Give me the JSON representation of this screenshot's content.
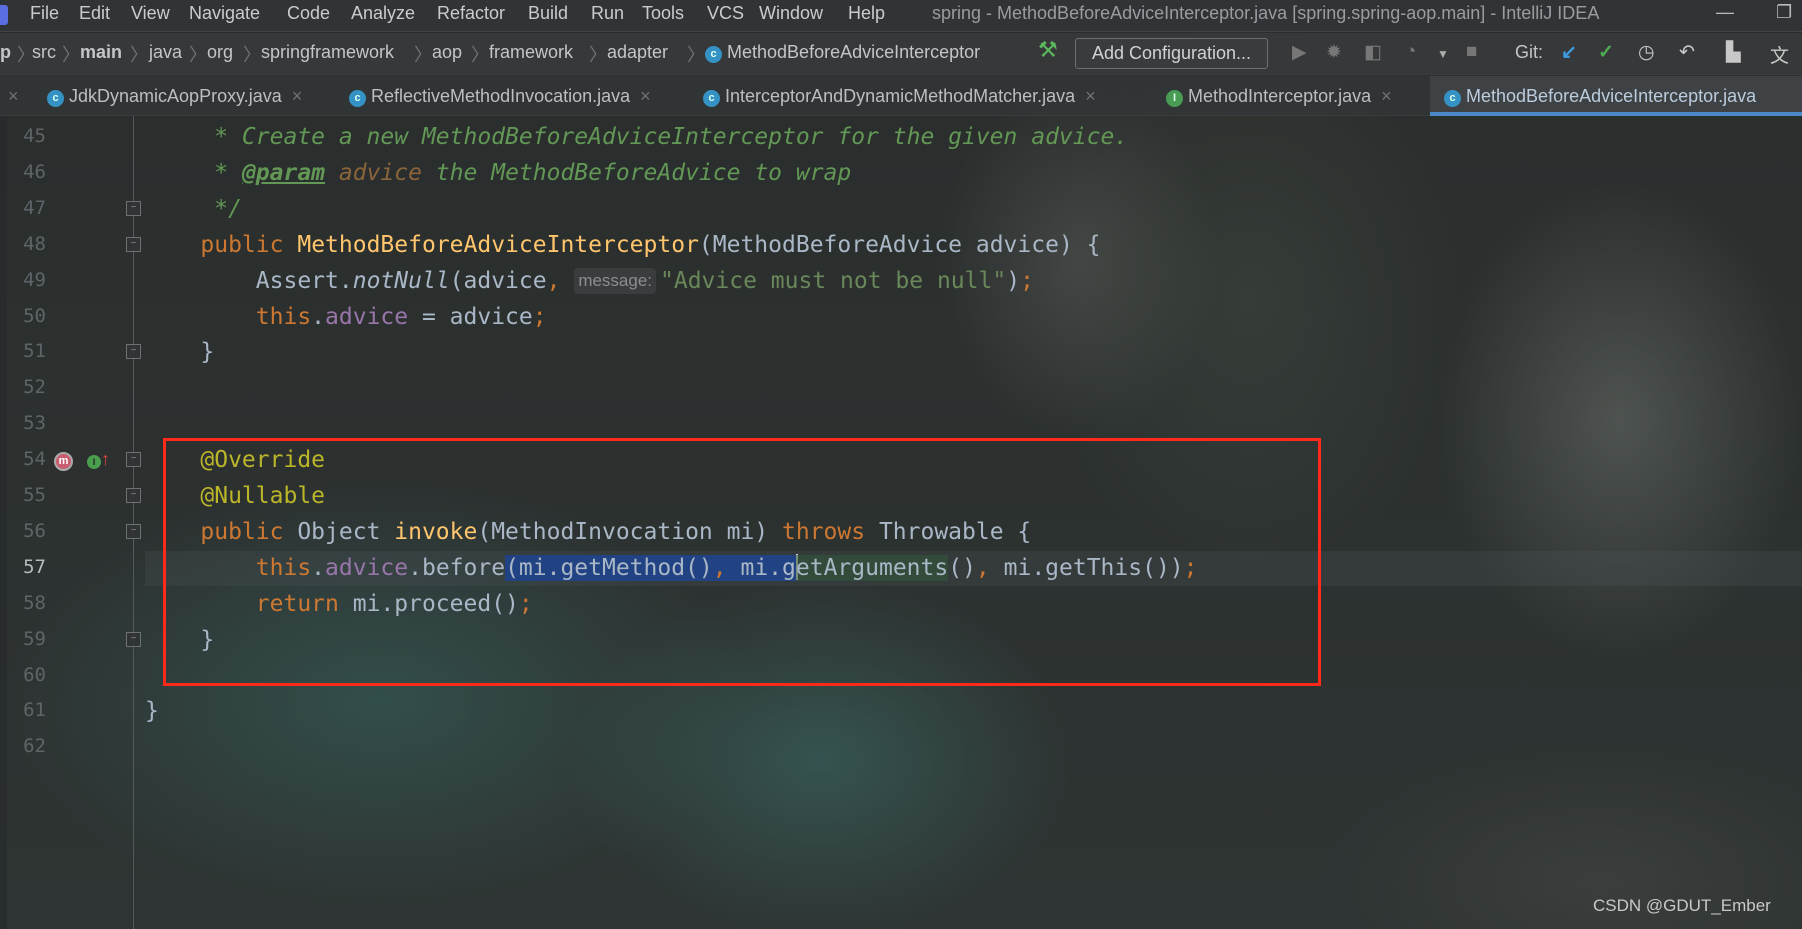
{
  "window": {
    "title": "spring - MethodBeforeAdviceInterceptor.java [spring.spring-aop.main] - IntelliJ IDEA",
    "minimize": "—",
    "restore": "❐"
  },
  "menu": [
    "File",
    "Edit",
    "View",
    "Navigate",
    "Code",
    "Analyze",
    "Refactor",
    "Build",
    "Run",
    "Tools",
    "VCS",
    "Window",
    "Help"
  ],
  "breadcrumb": [
    "p",
    "src",
    "main",
    "java",
    "org",
    "springframework",
    "aop",
    "framework",
    "adapter",
    "MethodBeforeAdviceInterceptor"
  ],
  "toolbar": {
    "add_configuration": "Add Configuration...",
    "git_label": "Git:",
    "icons": [
      "hammer-icon",
      "run-icon",
      "debug-icon",
      "coverage-icon",
      "profile-icon",
      "stop-icon",
      "git-update-icon",
      "git-commit-icon",
      "history-icon",
      "rollback-icon",
      "project-structure-icon",
      "translate-icon"
    ]
  },
  "tabs": [
    {
      "label": "JdkDynamicAopProxy.java",
      "icon": "C",
      "active": false
    },
    {
      "label": "ReflectiveMethodInvocation.java",
      "icon": "C",
      "active": false
    },
    {
      "label": "InterceptorAndDynamicMethodMatcher.java",
      "icon": "C",
      "active": false
    },
    {
      "label": "MethodInterceptor.java",
      "icon": "I",
      "active": false
    },
    {
      "label": "MethodBeforeAdviceInterceptor.java",
      "icon": "C",
      "active": true
    }
  ],
  "colors": {
    "highlight_box": "#ff2a1a",
    "selection": "#214283",
    "keyword": "#cc7832",
    "comment": "#629755"
  },
  "editor": {
    "current_line": 57,
    "lines": [
      {
        "n": 45,
        "tokens": [
          {
            "t": "     * Create a new MethodBeforeAdviceInterceptor for the given advice.",
            "c": "d"
          }
        ]
      },
      {
        "n": 46,
        "tokens": [
          {
            "t": "     * ",
            "c": "d"
          },
          {
            "t": "@param",
            "c": "dt"
          },
          {
            "t": " ",
            "c": "d"
          },
          {
            "t": "advice",
            "c": "dp"
          },
          {
            "t": " the MethodBeforeAdvice to wrap",
            "c": "d"
          }
        ]
      },
      {
        "n": 47,
        "tokens": [
          {
            "t": "     */",
            "c": "d"
          }
        ]
      },
      {
        "n": 48,
        "tokens": [
          {
            "t": "    "
          },
          {
            "t": "public",
            "c": "k"
          },
          {
            "t": " "
          },
          {
            "t": "MethodBeforeAdviceInterceptor",
            "c": "f"
          },
          {
            "t": "(MethodBeforeAdvice advice) {"
          }
        ]
      },
      {
        "n": 49,
        "tokens": [
          {
            "t": "        Assert."
          },
          {
            "t": "notNull",
            "c": "it"
          },
          {
            "t": "(advice"
          },
          {
            "t": ",",
            "c": "k"
          },
          {
            "t": " "
          },
          {
            "t": "message:",
            "c": "hint"
          },
          {
            "t": "\"Advice must not be null\"",
            "c": "s"
          },
          {
            "t": ")"
          },
          {
            "t": ";",
            "c": "k"
          }
        ]
      },
      {
        "n": 50,
        "tokens": [
          {
            "t": "        "
          },
          {
            "t": "this",
            "c": "k"
          },
          {
            "t": "."
          },
          {
            "t": "advice",
            "c": "fld"
          },
          {
            "t": " = advice"
          },
          {
            "t": ";",
            "c": "k"
          }
        ]
      },
      {
        "n": 51,
        "tokens": [
          {
            "t": "    }"
          }
        ]
      },
      {
        "n": 52,
        "tokens": []
      },
      {
        "n": 53,
        "tokens": []
      },
      {
        "n": 54,
        "tokens": [
          {
            "t": "    "
          },
          {
            "t": "@Override",
            "c": "a"
          }
        ]
      },
      {
        "n": 55,
        "tokens": [
          {
            "t": "    "
          },
          {
            "t": "@Nullable",
            "c": "a"
          }
        ]
      },
      {
        "n": 56,
        "tokens": [
          {
            "t": "    "
          },
          {
            "t": "public",
            "c": "k"
          },
          {
            "t": " Object "
          },
          {
            "t": "invoke",
            "c": "f"
          },
          {
            "t": "(MethodInvocation mi) "
          },
          {
            "t": "throws",
            "c": "k"
          },
          {
            "t": " Throwable {"
          }
        ]
      },
      {
        "n": 57,
        "tokens": [
          {
            "t": "        "
          },
          {
            "t": "this",
            "c": "k"
          },
          {
            "t": "."
          },
          {
            "t": "advice",
            "c": "fld"
          },
          {
            "t": ".before"
          },
          {
            "t": "(mi.getMethod()",
            "c": "sel"
          },
          {
            "t": ",",
            "c": "k sel"
          },
          {
            "t": " mi.g",
            "c": "sel"
          },
          {
            "t": "",
            "c": "caret"
          },
          {
            "t": "etArguments",
            "c": "use"
          },
          {
            "t": "()"
          },
          {
            "t": ",",
            "c": "k"
          },
          {
            "t": " mi.getThis())"
          },
          {
            "t": ";",
            "c": "k"
          }
        ]
      },
      {
        "n": 58,
        "tokens": [
          {
            "t": "        "
          },
          {
            "t": "return",
            "c": "k"
          },
          {
            "t": " mi.proceed()"
          },
          {
            "t": ";",
            "c": "k"
          }
        ]
      },
      {
        "n": 59,
        "tokens": [
          {
            "t": "    }"
          }
        ]
      },
      {
        "n": 60,
        "tokens": []
      },
      {
        "n": 61,
        "tokens": [
          {
            "t": "}"
          }
        ]
      },
      {
        "n": 62,
        "tokens": []
      }
    ],
    "fold_markers": [
      47,
      48,
      51,
      54,
      55,
      56,
      59
    ],
    "gutter_icons": {
      "line": 56,
      "items": [
        "overrides-method-icon",
        "implements-interface-icon"
      ]
    }
  },
  "watermark": "CSDN @GDUT_Ember"
}
